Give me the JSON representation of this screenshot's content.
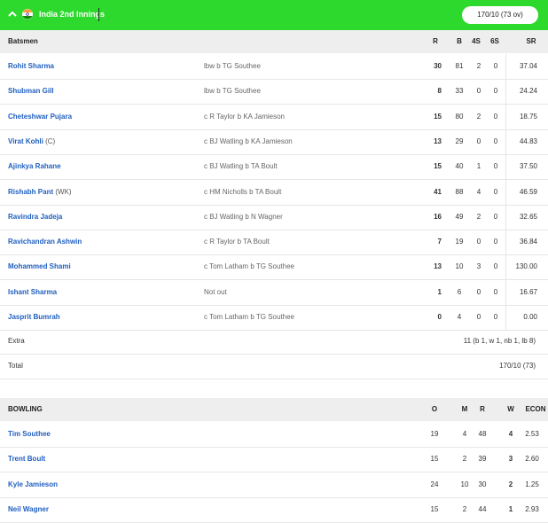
{
  "innings": {
    "title": "India 2nd Innings",
    "score": "170/10 (73 ov)"
  },
  "batting": {
    "headers": {
      "batsmen": "Batsmen",
      "r": "R",
      "b": "B",
      "fours": "4S",
      "sixes": "6S",
      "sr": "SR"
    },
    "rows": [
      {
        "name": "Rohit Sharma",
        "role": "",
        "dismissal": "lbw b TG Southee",
        "r": "30",
        "b": "81",
        "fours": "2",
        "sixes": "0",
        "sr": "37.04"
      },
      {
        "name": "Shubman Gill",
        "role": "",
        "dismissal": "lbw b TG Southee",
        "r": "8",
        "b": "33",
        "fours": "0",
        "sixes": "0",
        "sr": "24.24"
      },
      {
        "name": "Cheteshwar Pujara",
        "role": "",
        "dismissal": "c R Taylor b KA Jamieson",
        "r": "15",
        "b": "80",
        "fours": "2",
        "sixes": "0",
        "sr": "18.75"
      },
      {
        "name": "Virat Kohli",
        "role": "(C)",
        "dismissal": "c BJ Watling b KA Jamieson",
        "r": "13",
        "b": "29",
        "fours": "0",
        "sixes": "0",
        "sr": "44.83"
      },
      {
        "name": "Ajinkya Rahane",
        "role": "",
        "dismissal": "c BJ Watling b TA Boult",
        "r": "15",
        "b": "40",
        "fours": "1",
        "sixes": "0",
        "sr": "37.50"
      },
      {
        "name": "Rishabh Pant",
        "role": "(WK)",
        "dismissal": "c HM Nicholls b TA Boult",
        "r": "41",
        "b": "88",
        "fours": "4",
        "sixes": "0",
        "sr": "46.59"
      },
      {
        "name": "Ravindra Jadeja",
        "role": "",
        "dismissal": "c BJ Watling b N Wagner",
        "r": "16",
        "b": "49",
        "fours": "2",
        "sixes": "0",
        "sr": "32.65"
      },
      {
        "name": "Ravichandran Ashwin",
        "role": "",
        "dismissal": "c R Taylor b TA Boult",
        "r": "7",
        "b": "19",
        "fours": "0",
        "sixes": "0",
        "sr": "36.84"
      },
      {
        "name": "Mohammed Shami",
        "role": "",
        "dismissal": "c Tom Latham b TG Southee",
        "r": "13",
        "b": "10",
        "fours": "3",
        "sixes": "0",
        "sr": "130.00"
      },
      {
        "name": "Ishant Sharma",
        "role": "",
        "dismissal": "Not out",
        "r": "1",
        "b": "6",
        "fours": "0",
        "sixes": "0",
        "sr": "16.67"
      },
      {
        "name": "Jasprit Bumrah",
        "role": "",
        "dismissal": "c Tom Latham b TG Southee",
        "r": "0",
        "b": "4",
        "fours": "0",
        "sixes": "0",
        "sr": "0.00"
      }
    ],
    "extras": {
      "label": "Extra",
      "value": "11 (b 1, w 1, nb 1, lb 8)"
    },
    "total": {
      "label": "Total",
      "value": "170/10 (73)"
    }
  },
  "bowling": {
    "headers": {
      "bowling": "BOWLING",
      "o": "O",
      "m": "M",
      "r": "R",
      "w": "W",
      "econ": "ECON"
    },
    "rows": [
      {
        "name": "Tim Southee",
        "o": "19",
        "m": "4",
        "r": "48",
        "w": "4",
        "econ": "2.53"
      },
      {
        "name": "Trent Boult",
        "o": "15",
        "m": "2",
        "r": "39",
        "w": "3",
        "econ": "2.60"
      },
      {
        "name": "Kyle Jamieson",
        "o": "24",
        "m": "10",
        "r": "30",
        "w": "2",
        "econ": "1.25"
      },
      {
        "name": "Neil Wagner",
        "o": "15",
        "m": "2",
        "r": "44",
        "w": "1",
        "econ": "2.93"
      }
    ]
  },
  "colors": {
    "header_green": "#2ed92e",
    "name_blue": "#1f5fbf",
    "thead_gray": "#eeeeee"
  }
}
